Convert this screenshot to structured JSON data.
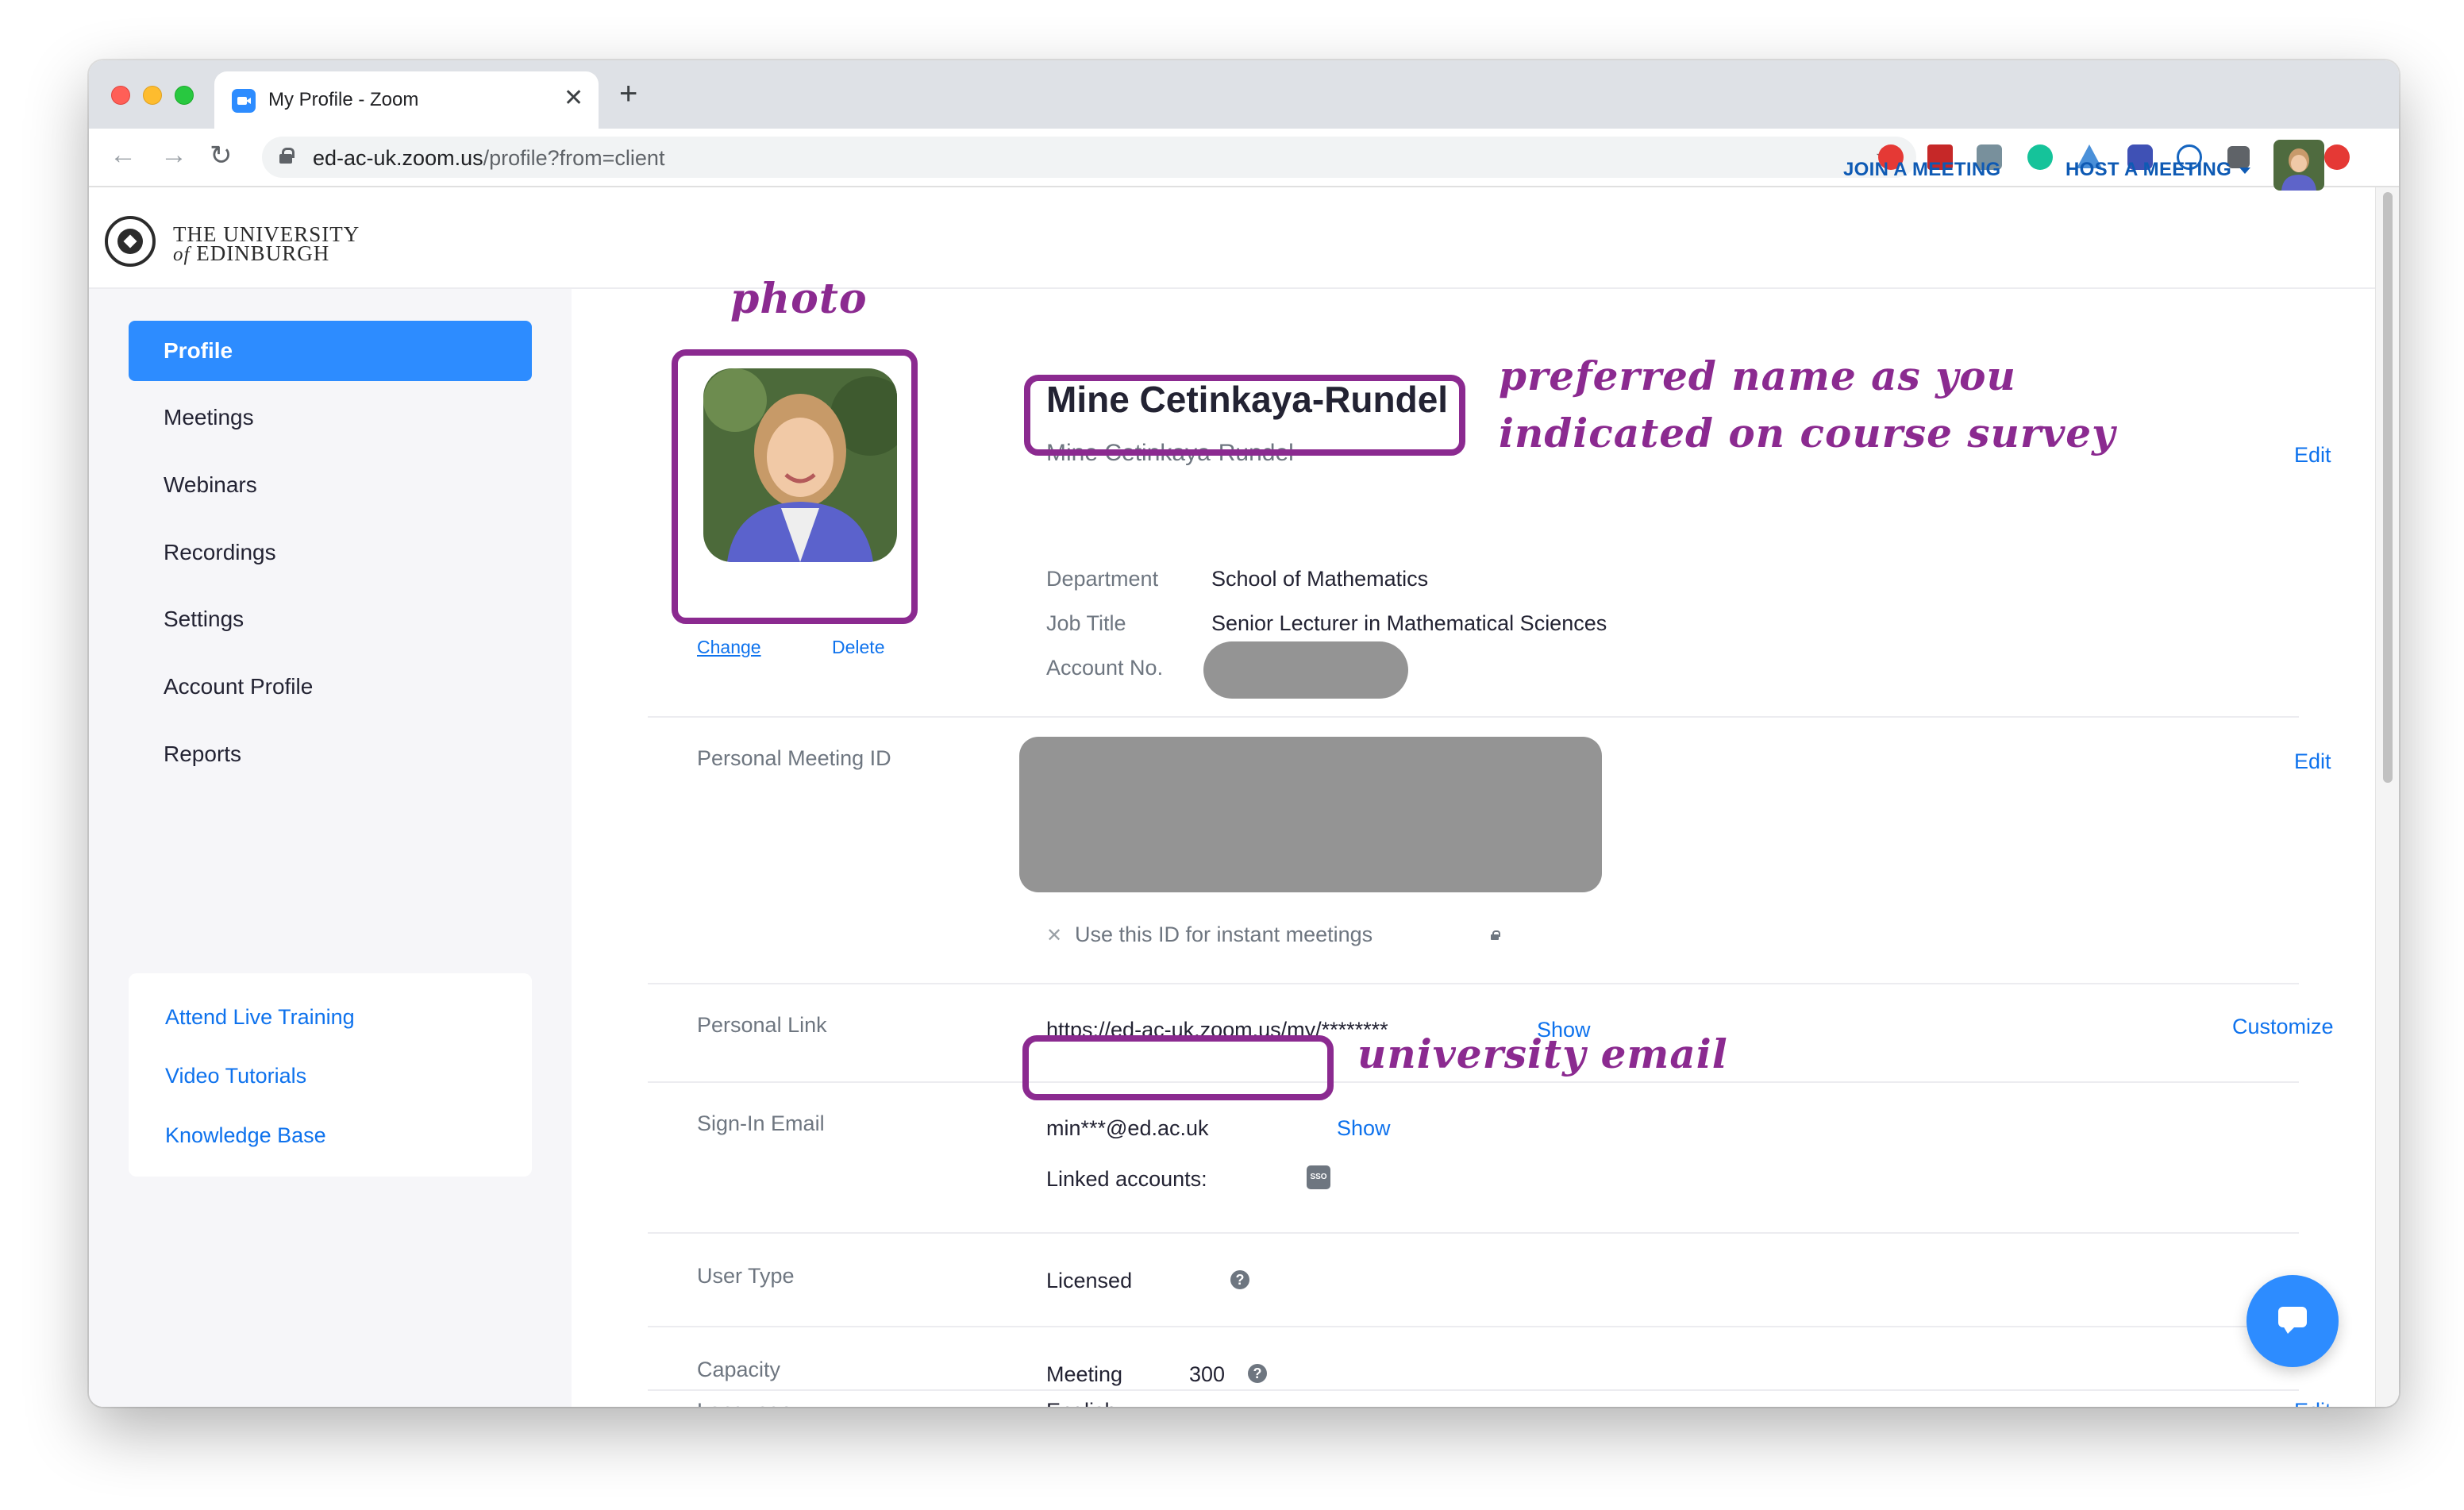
{
  "browser": {
    "tab_title": "My Profile - Zoom",
    "tab_close": "✕",
    "new_tab": "+",
    "url_host": "ed-ac-uk.zoom.us",
    "url_path": "/profile?from=client",
    "back_glyph": "←",
    "forward_glyph": "→",
    "reload_glyph": "↻",
    "star_glyph": "☆"
  },
  "header": {
    "university_line1": "THE UNIVERSITY",
    "university_of": "of",
    "university_line2": "EDINBURGH",
    "join_meeting": "JOIN A MEETING",
    "host_meeting": "HOST A MEETING"
  },
  "sidebar": {
    "items": [
      {
        "label": "Profile",
        "active": true
      },
      {
        "label": "Meetings"
      },
      {
        "label": "Webinars"
      },
      {
        "label": "Recordings"
      },
      {
        "label": "Settings"
      },
      {
        "label": "Account Profile"
      },
      {
        "label": "Reports"
      }
    ],
    "help_links": [
      "Attend Live Training",
      "Video Tutorials",
      "Knowledge Base"
    ]
  },
  "profile": {
    "change_label": "Change",
    "delete_label": "Delete",
    "display_name": "Mine Cetinkaya-Rundel",
    "sub_name": "Mine Cetinkaya-Rundel",
    "edit_label": "Edit",
    "department_label": "Department",
    "department_value": "School of Mathematics",
    "job_title_label": "Job Title",
    "job_title_value": "Senior Lecturer in Mathematical Sciences",
    "account_no_label": "Account No."
  },
  "pmi": {
    "label": "Personal Meeting ID",
    "edit_label": "Edit",
    "instant_label": "Use this ID for instant meetings"
  },
  "personal_link": {
    "label": "Personal Link",
    "value": "https://ed-ac-uk.zoom.us/my/********",
    "show_label": "Show",
    "customize_label": "Customize"
  },
  "sign_in_email": {
    "label": "Sign-In Email",
    "value": "min***@ed.ac.uk",
    "show_label": "Show",
    "linked_label": "Linked accounts:",
    "sso_label": "SSO"
  },
  "user_type": {
    "label": "User Type",
    "value": "Licensed"
  },
  "capacity": {
    "label": "Capacity",
    "type": "Meeting",
    "value": "300"
  },
  "language": {
    "label": "Language",
    "value": "English",
    "edit_label": "Edit"
  },
  "annotations": {
    "photo": "photo",
    "preferred_line1": "preferred name as you",
    "preferred_line2": "indicated on course survey",
    "email": "university email",
    "color": "#8b2a90"
  },
  "colors": {
    "zoom_blue": "#2d8cff",
    "link_blue": "#0e72ed",
    "header_link": "#0e5ab4"
  }
}
